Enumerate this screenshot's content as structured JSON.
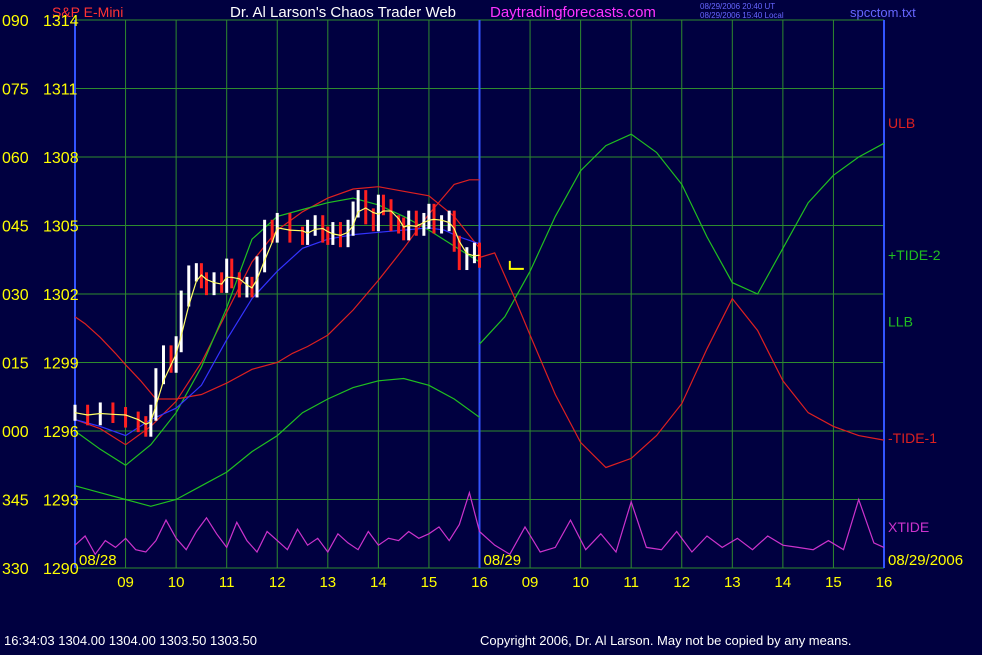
{
  "header": {
    "instrument": "S&P E-Mini",
    "title": "Dr. Al Larson's Chaos Trader Web",
    "site": "Daytradingforecasts.com",
    "timestamp_ut": "08/29/2006 20:40 UT",
    "timestamp_local": "08/29/2006 15:40 Local",
    "file": "spcctom.txt"
  },
  "footer": {
    "quote": "16:34:03  1304.00 1304.00 1303.50 1303.50",
    "copyright": "Copyright 2006, Dr. Al Larson. May not be copied by any means."
  },
  "colors": {
    "background": "#000040",
    "grid": "#2e8b2e",
    "axis": "#3355ff",
    "price_up": "#ffffff",
    "price_down": "#ff2020",
    "moving_avg": "#ffff66",
    "ulb": "#dd2020",
    "llb": "#20c020",
    "tide_plus": "#20c020",
    "tide_minus": "#dd2020",
    "xtide": "#cc33cc",
    "trend_blue": "#3333ff",
    "label_yellow": "#ffff00",
    "title_white": "#ffffff",
    "site_magenta": "#ff33ff",
    "small_blue": "#6666ff"
  },
  "chart_data": {
    "type": "line",
    "title": "Dr. Al Larson's Chaos Trader Web",
    "xlim": [
      8,
      16
    ],
    "price_range": [
      1290,
      1314
    ],
    "grid": true,
    "left_axis_labels": [
      {
        "degree": "090",
        "price": "1314"
      },
      {
        "degree": "075",
        "price": "1311"
      },
      {
        "degree": "060",
        "price": "1308"
      },
      {
        "degree": "045",
        "price": "1305"
      },
      {
        "degree": "030",
        "price": "1302"
      },
      {
        "degree": "015",
        "price": "1299"
      },
      {
        "degree": "000",
        "price": "1296"
      },
      {
        "degree": "345",
        "price": "1293"
      },
      {
        "degree": "330",
        "price": "1290"
      }
    ],
    "panels": [
      {
        "date": "08/28",
        "hours": [
          "09",
          "10",
          "11",
          "12",
          "13",
          "14",
          "15",
          "16"
        ]
      },
      {
        "date": "08/29",
        "hours": [
          "09",
          "10",
          "11",
          "12",
          "13",
          "14",
          "15",
          "16"
        ]
      }
    ],
    "right_date": "08/29/2006",
    "legend": [
      {
        "name": "ULB",
        "color": "#dd2020",
        "price": 1309.5
      },
      {
        "name": "+TIDE-2",
        "color": "#20c020",
        "price": 1303.7
      },
      {
        "name": "LLB",
        "color": "#20c020",
        "price": 1300.8
      },
      {
        "name": "-TIDE-1",
        "color": "#dd2020",
        "price": 1295.7
      },
      {
        "name": "XTIDE",
        "color": "#cc33cc",
        "price": 1291.8
      }
    ],
    "price_series": {
      "name": "S&P E-Mini",
      "x": [
        8.0,
        8.25,
        8.5,
        8.75,
        9.0,
        9.25,
        9.4,
        9.5,
        9.6,
        9.75,
        9.9,
        10.0,
        10.1,
        10.25,
        10.4,
        10.5,
        10.6,
        10.75,
        10.9,
        11.0,
        11.1,
        11.25,
        11.4,
        11.5,
        11.6,
        11.75,
        11.9,
        12.0,
        12.25,
        12.5,
        12.6,
        12.75,
        12.9,
        13.0,
        13.1,
        13.25,
        13.4,
        13.5,
        13.6,
        13.75,
        13.9,
        14.0,
        14.1,
        14.25,
        14.4,
        14.5,
        14.6,
        14.75,
        14.9,
        15.0,
        15.1,
        15.25,
        15.4,
        15.5,
        15.6,
        15.75,
        15.9,
        16.0
      ],
      "y": [
        1296.8,
        1296.6,
        1296.9,
        1296.7,
        1296.5,
        1296.3,
        1296.1,
        1296.8,
        1298.4,
        1299.4,
        1298.9,
        1299.8,
        1301.8,
        1302.9,
        1303.0,
        1302.6,
        1302.3,
        1302.6,
        1302.4,
        1303.2,
        1302.6,
        1302.2,
        1302.4,
        1302.2,
        1303.3,
        1304.9,
        1304.6,
        1305.2,
        1304.6,
        1304.5,
        1304.9,
        1305.1,
        1304.6,
        1304.5,
        1304.8,
        1304.4,
        1304.9,
        1305.7,
        1306.2,
        1305.4,
        1305.1,
        1306.0,
        1305.8,
        1305.1,
        1305.0,
        1304.7,
        1305.3,
        1304.9,
        1305.2,
        1305.6,
        1305.0,
        1305.1,
        1305.3,
        1304.2,
        1303.4,
        1303.7,
        1303.9,
        1303.5
      ]
    },
    "series": [
      {
        "id": "ulb_day1",
        "color": "#dd2020",
        "x": [
          8,
          8.5,
          9,
          9.5,
          10,
          10.5,
          11,
          11.5,
          12,
          12.5,
          13,
          13.5,
          14,
          14.5,
          15,
          15.5,
          16
        ],
        "y": [
          1296.5,
          1296.1,
          1295.4,
          1296.2,
          1297.3,
          1299.0,
          1301.2,
          1303.4,
          1304.8,
          1305.6,
          1306.2,
          1306.6,
          1306.7,
          1306.5,
          1306.3,
          1305.4,
          1304.0
        ]
      },
      {
        "id": "llb_day1",
        "color": "#20c020",
        "x": [
          8,
          8.5,
          9,
          9.5,
          10,
          10.5,
          11,
          11.5,
          12,
          12.5,
          13,
          13.5,
          14,
          14.5,
          15,
          15.5,
          16
        ],
        "y": [
          1296.0,
          1295.2,
          1294.5,
          1295.4,
          1296.8,
          1298.8,
          1301.4,
          1304.4,
          1305.4,
          1305.7,
          1306.0,
          1306.2,
          1305.9,
          1305.4,
          1304.8,
          1304.1,
          1303.4
        ]
      },
      {
        "id": "tide_red_day1",
        "color": "#dd2020",
        "x": [
          8,
          8.2,
          8.5,
          8.8,
          9,
          9.3,
          9.6,
          10,
          10.5,
          11,
          11.5,
          12,
          12.3,
          12.6,
          13,
          13.5,
          14,
          14.5,
          15,
          15.5,
          15.8,
          16
        ],
        "y": [
          1301.0,
          1300.7,
          1300.1,
          1299.4,
          1298.9,
          1298.2,
          1297.4,
          1297.4,
          1297.6,
          1298.1,
          1298.7,
          1299.0,
          1299.4,
          1299.7,
          1300.2,
          1301.3,
          1302.6,
          1304.0,
          1305.5,
          1306.8,
          1307.0,
          1307.0
        ]
      },
      {
        "id": "tide_green_day1",
        "color": "#20c020",
        "x": [
          8,
          8.5,
          9,
          9.5,
          10,
          10.5,
          11,
          11.5,
          12,
          12.5,
          13,
          13.5,
          14,
          14.5,
          15,
          15.5,
          16
        ],
        "y": [
          1293.6,
          1293.3,
          1293.0,
          1292.7,
          1293.0,
          1293.6,
          1294.2,
          1295.1,
          1295.8,
          1296.8,
          1297.4,
          1297.9,
          1298.2,
          1298.3,
          1298.0,
          1297.4,
          1296.6
        ]
      },
      {
        "id": "blue_trend",
        "color": "#3333ff",
        "x": [
          8,
          8.5,
          9,
          9.5,
          10,
          10.5,
          11,
          11.5,
          12,
          12.5,
          13,
          13.5,
          14,
          14.5,
          15,
          15.3,
          15.6,
          16
        ],
        "y": [
          1296.5,
          1296.2,
          1295.8,
          1296.5,
          1297.0,
          1298.0,
          1300.0,
          1301.8,
          1303.0,
          1304.0,
          1304.4,
          1304.6,
          1304.7,
          1304.8,
          1304.9,
          1304.8,
          1304.5,
          1304.2
        ]
      },
      {
        "id": "tide_green_day2",
        "color": "#20c020",
        "x": [
          16,
          16.5,
          17,
          17.5,
          18,
          18.5,
          19,
          19.5,
          20,
          20.5,
          21,
          21.5,
          22,
          22.5,
          23,
          23.5,
          24
        ],
        "y": [
          1299.8,
          1301.0,
          1303.0,
          1305.4,
          1307.4,
          1308.5,
          1309.0,
          1308.2,
          1306.8,
          1304.5,
          1302.5,
          1302.0,
          1304.0,
          1306.0,
          1307.2,
          1308.0,
          1308.6
        ]
      },
      {
        "id": "tide_red_day2",
        "color": "#dd2020",
        "x": [
          16,
          16.3,
          16.7,
          17,
          17.5,
          18,
          18.5,
          19,
          19.5,
          20,
          20.5,
          21,
          21.5,
          22,
          22.5,
          23,
          23.5,
          24
        ],
        "y": [
          1303.6,
          1303.8,
          1301.8,
          1300.2,
          1297.6,
          1295.5,
          1294.4,
          1294.8,
          1295.8,
          1297.2,
          1299.6,
          1301.8,
          1300.4,
          1298.2,
          1296.8,
          1296.2,
          1295.8,
          1295.6
        ]
      },
      {
        "id": "xtide",
        "color": "#cc33cc",
        "x": [
          8,
          8.2,
          8.4,
          8.6,
          8.8,
          9.0,
          9.2,
          9.4,
          9.6,
          9.8,
          10.0,
          10.2,
          10.4,
          10.6,
          10.8,
          11.0,
          11.2,
          11.4,
          11.6,
          11.8,
          12.0,
          12.2,
          12.4,
          12.6,
          12.8,
          13.0,
          13.2,
          13.4,
          13.6,
          13.8,
          14.0,
          14.2,
          14.4,
          14.6,
          14.8,
          15.0,
          15.2,
          15.4,
          15.6,
          15.8,
          16.0,
          16.3,
          16.6,
          16.9,
          17.2,
          17.5,
          17.8,
          18.1,
          18.4,
          18.7,
          19.0,
          19.3,
          19.6,
          19.9,
          20.2,
          20.5,
          20.8,
          21.1,
          21.4,
          21.7,
          22.0,
          22.3,
          22.6,
          22.9,
          23.2,
          23.5,
          23.8,
          24
        ],
        "y": [
          1291.0,
          1291.4,
          1290.6,
          1291.2,
          1290.9,
          1291.3,
          1290.8,
          1290.7,
          1291.2,
          1292.1,
          1291.3,
          1290.8,
          1291.6,
          1292.2,
          1291.5,
          1290.9,
          1292.0,
          1291.2,
          1290.7,
          1291.6,
          1291.2,
          1290.8,
          1291.7,
          1291.0,
          1291.3,
          1290.7,
          1291.5,
          1291.1,
          1290.8,
          1291.6,
          1291.0,
          1291.3,
          1291.2,
          1291.6,
          1291.3,
          1291.5,
          1291.8,
          1291.2,
          1291.9,
          1293.3,
          1291.6,
          1291.0,
          1290.6,
          1291.8,
          1290.7,
          1290.9,
          1292.1,
          1290.8,
          1291.5,
          1290.7,
          1292.9,
          1290.9,
          1290.8,
          1291.6,
          1290.7,
          1291.4,
          1290.9,
          1291.3,
          1290.8,
          1291.4,
          1291.0,
          1290.9,
          1290.8,
          1291.2,
          1290.8,
          1293.0,
          1291.1,
          1290.9
        ]
      }
    ],
    "annotations": [
      {
        "id": "yellow_marker",
        "x": 16.6,
        "y": 1303.1,
        "color": "#ffff00"
      }
    ]
  }
}
